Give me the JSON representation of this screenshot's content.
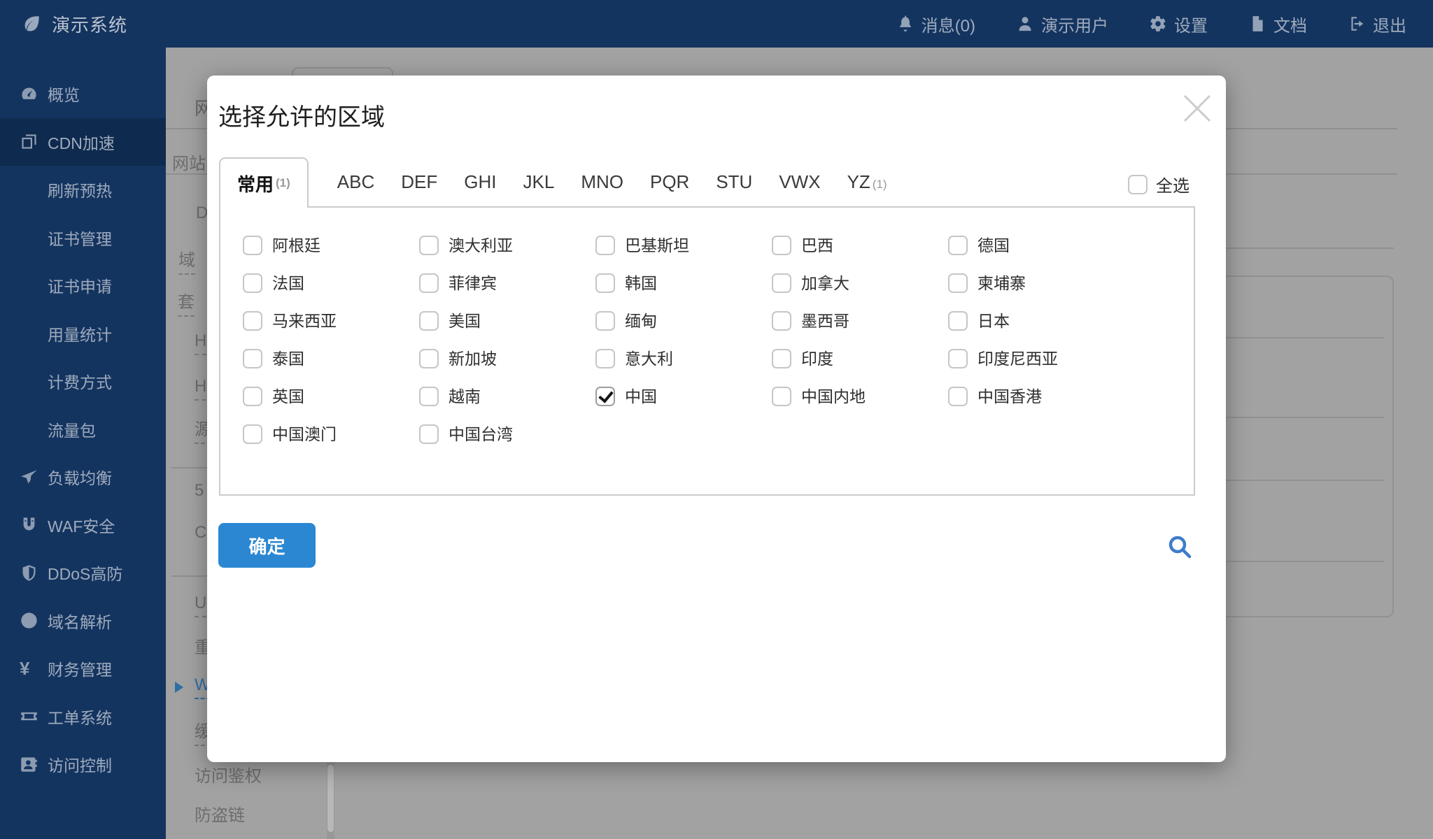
{
  "navbar": {
    "brand": "演示系统",
    "items": [
      {
        "icon": "bell-icon",
        "label": "消息(0)"
      },
      {
        "icon": "user-icon",
        "label": "演示用户"
      },
      {
        "icon": "gear-icon",
        "label": "设置"
      },
      {
        "icon": "document-icon",
        "label": "文档"
      },
      {
        "icon": "logout-icon",
        "label": "退出"
      }
    ]
  },
  "sidebar": {
    "items": [
      {
        "icon": "gauge-icon",
        "label": "概览",
        "level": 1,
        "active": false
      },
      {
        "icon": "layers-icon",
        "label": "CDN加速",
        "level": 1,
        "active": true
      },
      {
        "icon": "",
        "label": "刷新预热",
        "level": 2,
        "active": false
      },
      {
        "icon": "",
        "label": "证书管理",
        "level": 2,
        "active": false
      },
      {
        "icon": "",
        "label": "证书申请",
        "level": 2,
        "active": false
      },
      {
        "icon": "",
        "label": "用量统计",
        "level": 2,
        "active": false
      },
      {
        "icon": "",
        "label": "计费方式",
        "level": 2,
        "active": false
      },
      {
        "icon": "",
        "label": "流量包",
        "level": 2,
        "active": false
      },
      {
        "icon": "paper-plane-icon",
        "label": "负载均衡",
        "level": 1,
        "active": false
      },
      {
        "icon": "magnet-icon",
        "label": "WAF安全",
        "level": 1,
        "active": false
      },
      {
        "icon": "shield-icon",
        "label": "DDoS高防",
        "level": 1,
        "active": false
      },
      {
        "icon": "globe-icon",
        "label": "域名解析",
        "level": 1,
        "active": false
      },
      {
        "icon": "yen-icon",
        "label": "财务管理",
        "level": 1,
        "active": false
      },
      {
        "icon": "ticket-icon",
        "label": "工单系统",
        "level": 1,
        "active": false
      },
      {
        "icon": "id-card-icon",
        "label": "访问控制",
        "level": 1,
        "active": false
      }
    ]
  },
  "background": {
    "fragments": [
      "网",
      "网站",
      "D",
      "域",
      "套",
      "H",
      "H",
      "源",
      "5",
      "C",
      "U",
      "重",
      "W",
      "缓",
      "访问鉴权",
      "防盗链"
    ]
  },
  "modal": {
    "title": "选择允许的区域",
    "tabs": [
      {
        "label": "常用",
        "count": "(1)",
        "active": true
      },
      {
        "label": "ABC",
        "count": "",
        "active": false
      },
      {
        "label": "DEF",
        "count": "",
        "active": false
      },
      {
        "label": "GHI",
        "count": "",
        "active": false
      },
      {
        "label": "JKL",
        "count": "",
        "active": false
      },
      {
        "label": "MNO",
        "count": "",
        "active": false
      },
      {
        "label": "PQR",
        "count": "",
        "active": false
      },
      {
        "label": "STU",
        "count": "",
        "active": false
      },
      {
        "label": "VWX",
        "count": "",
        "active": false
      },
      {
        "label": "YZ",
        "count": "(1)",
        "active": false
      }
    ],
    "select_all_label": "全选",
    "regions": [
      {
        "label": "阿根廷",
        "checked": false
      },
      {
        "label": "澳大利亚",
        "checked": false
      },
      {
        "label": "巴基斯坦",
        "checked": false
      },
      {
        "label": "巴西",
        "checked": false
      },
      {
        "label": "德国",
        "checked": false
      },
      {
        "label": "法国",
        "checked": false
      },
      {
        "label": "菲律宾",
        "checked": false
      },
      {
        "label": "韩国",
        "checked": false
      },
      {
        "label": "加拿大",
        "checked": false
      },
      {
        "label": "柬埔寨",
        "checked": false
      },
      {
        "label": "马来西亚",
        "checked": false
      },
      {
        "label": "美国",
        "checked": false
      },
      {
        "label": "缅甸",
        "checked": false
      },
      {
        "label": "墨西哥",
        "checked": false
      },
      {
        "label": "日本",
        "checked": false
      },
      {
        "label": "泰国",
        "checked": false
      },
      {
        "label": "新加坡",
        "checked": false
      },
      {
        "label": "意大利",
        "checked": false
      },
      {
        "label": "印度",
        "checked": false
      },
      {
        "label": "印度尼西亚",
        "checked": false
      },
      {
        "label": "英国",
        "checked": false
      },
      {
        "label": "越南",
        "checked": false
      },
      {
        "label": "中国",
        "checked": true
      },
      {
        "label": "中国内地",
        "checked": false
      },
      {
        "label": "中国香港",
        "checked": false
      },
      {
        "label": "中国澳门",
        "checked": false
      },
      {
        "label": "中国台湾",
        "checked": false
      }
    ],
    "confirm_label": "确定"
  },
  "colors": {
    "navy": "#143460",
    "navy_active": "#0e2a4e",
    "accent_blue": "#2b87d2",
    "search_blue": "#3d7cc9",
    "overlay_grey": "#a2a2a2"
  }
}
